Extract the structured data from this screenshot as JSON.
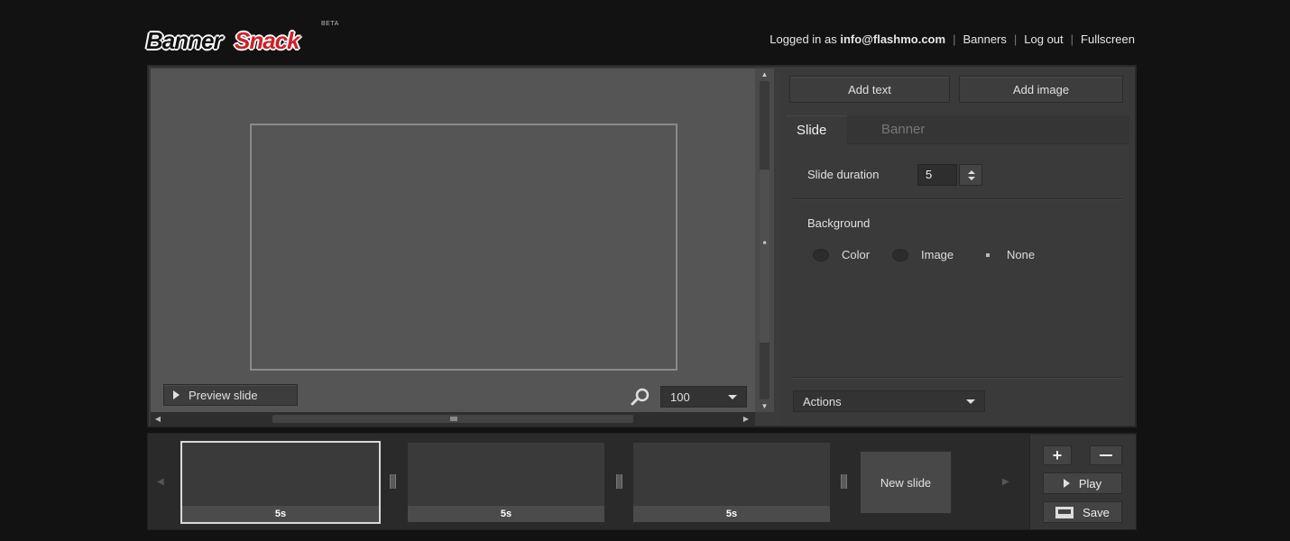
{
  "app": {
    "logo_word1": "Banner",
    "logo_word2": "Snack",
    "logo_badge": "BETA",
    "brand_red": "#d0202a"
  },
  "topnav": {
    "logged_in_prefix": "Logged in as",
    "user_email": "info@flashmo.com",
    "banners_link": "Banners",
    "logout_link": "Log out",
    "fullscreen_link": "Fullscreen",
    "separator": "|"
  },
  "stage": {
    "preview_label": "Preview slide",
    "zoom_value": "100"
  },
  "panel": {
    "add_text_label": "Add text",
    "add_image_label": "Add image",
    "tabs": [
      {
        "label": "Slide",
        "active": true
      },
      {
        "label": "Banner",
        "active": false
      }
    ],
    "slide_duration_label": "Slide duration",
    "slide_duration_value": "5",
    "background_label": "Background",
    "background_options": [
      {
        "label": "Color",
        "selected": false
      },
      {
        "label": "Image",
        "selected": false
      },
      {
        "label": "None",
        "selected": true
      }
    ],
    "actions_label": "Actions"
  },
  "timeline": {
    "slides": [
      {
        "duration": "5s",
        "selected": true
      },
      {
        "duration": "5s",
        "selected": false
      },
      {
        "duration": "5s",
        "selected": false
      }
    ],
    "new_slide_label": "New slide",
    "zoom_in_label": "+",
    "play_label": "Play",
    "save_label": "Save"
  }
}
